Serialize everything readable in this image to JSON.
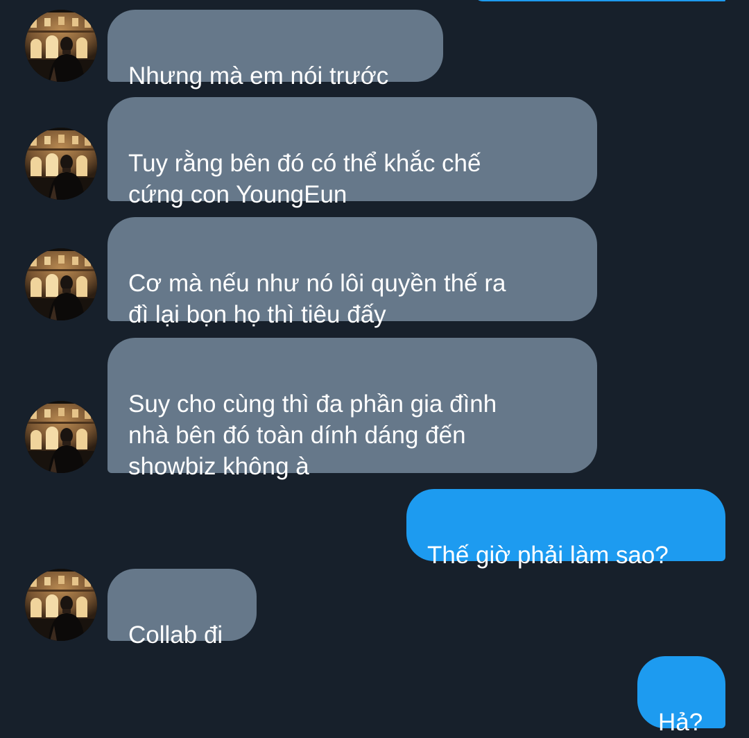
{
  "conversation": {
    "messages": [
      {
        "sender": "contact",
        "text": "Nhưng mà em nói trước",
        "avatar": "contact-avatar"
      },
      {
        "sender": "contact",
        "text": "Tuy rằng bên đó có thể khắc chế\ncứng con YoungEun",
        "avatar": "contact-avatar"
      },
      {
        "sender": "contact",
        "text": "Cơ mà nếu như nó lôi quyền thế ra\nđì lại bọn họ thì tiêu đấy",
        "avatar": "contact-avatar"
      },
      {
        "sender": "contact",
        "text": "Suy cho cùng thì đa phần gia đình\nnhà bên đó toàn dính dáng đến\nshowbiz không à",
        "avatar": "contact-avatar"
      },
      {
        "sender": "me",
        "text": "Thế giờ phải làm sao?"
      },
      {
        "sender": "contact",
        "text": "Collab đi",
        "avatar": "contact-avatar"
      },
      {
        "sender": "me",
        "text": "Hả?"
      }
    ]
  },
  "theme": {
    "background": "#17202b",
    "incoming_bubble": "#66788a",
    "outgoing_bubble": "#1d9bf0",
    "text": "#ffffff"
  }
}
